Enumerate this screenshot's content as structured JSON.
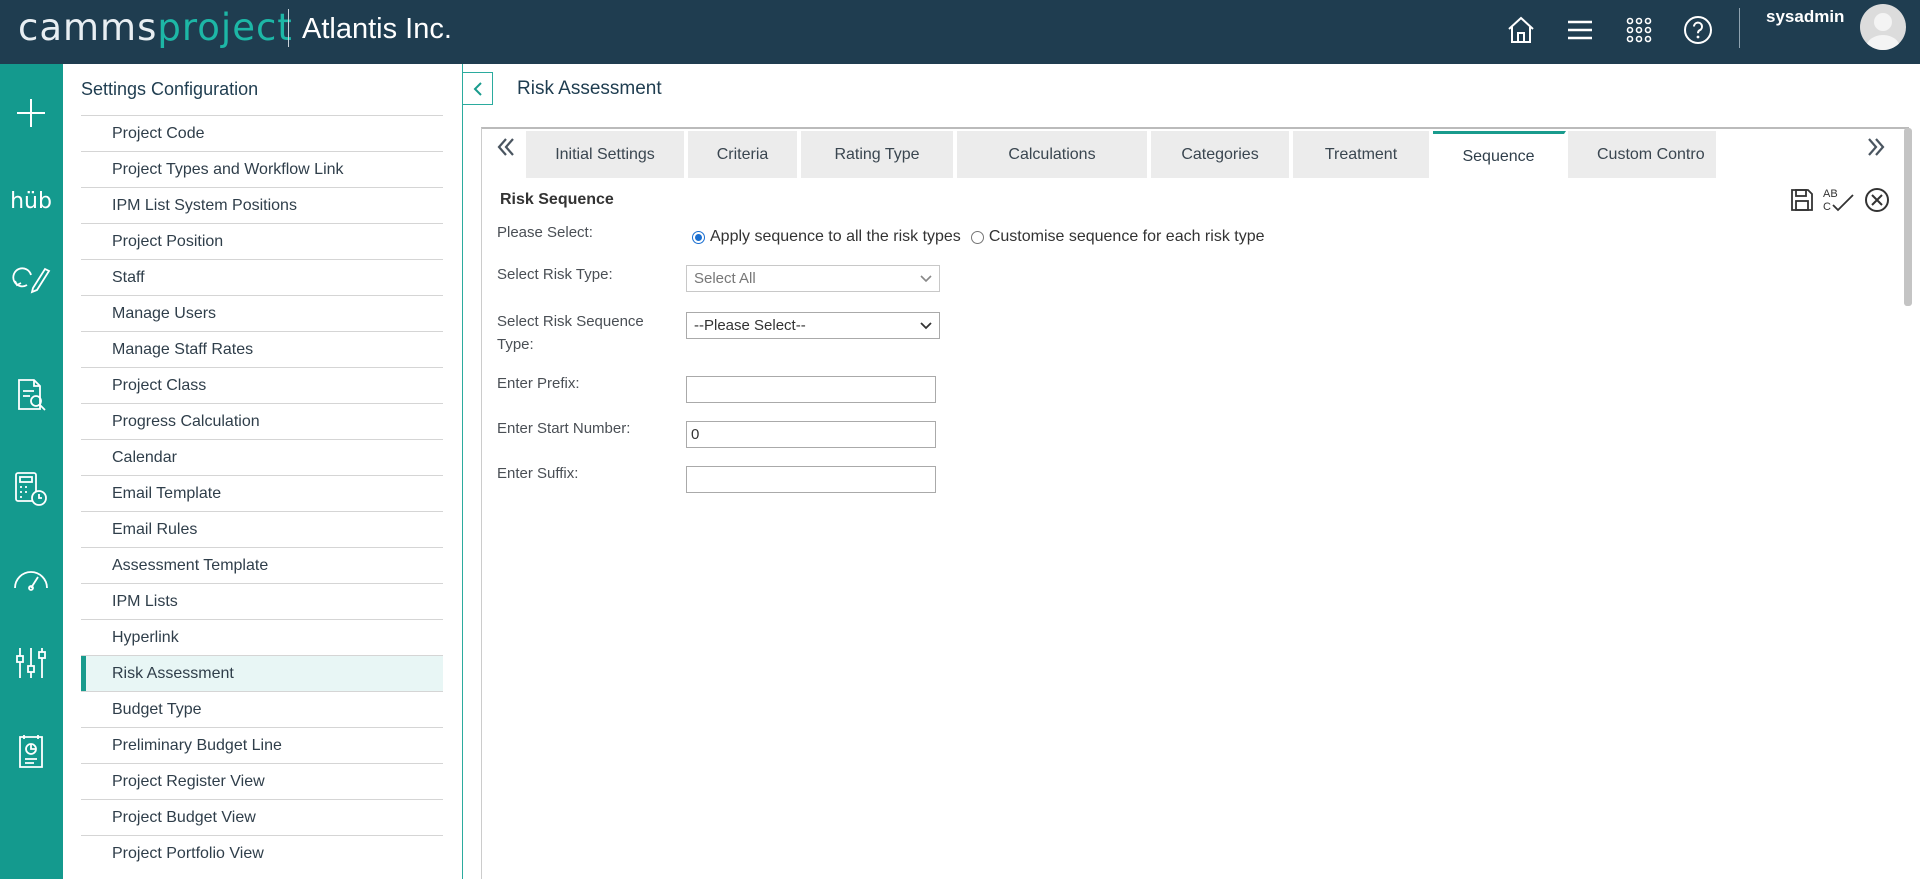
{
  "header": {
    "logo_part1": "camms",
    "logo_part2": "project",
    "company": "Atlantis Inc.",
    "username": "sysadmin",
    "icons": [
      "home-icon",
      "menu-icon",
      "apps-grid-icon",
      "help-icon"
    ]
  },
  "rail": {
    "icons": [
      "add-icon",
      "hub-icon",
      "edit-cycle-icon",
      "document-search-icon",
      "calculator-clock-icon",
      "gauge-icon",
      "settings-sliders-icon",
      "report-icon"
    ],
    "hub_label": "hüb"
  },
  "settings": {
    "title": "Settings Configuration",
    "items": [
      {
        "label": "Project Code"
      },
      {
        "label": "Project Types and Workflow Link"
      },
      {
        "label": "IPM List System Positions"
      },
      {
        "label": "Project Position"
      },
      {
        "label": "Staff"
      },
      {
        "label": "Manage Users"
      },
      {
        "label": "Manage Staff Rates"
      },
      {
        "label": "Project Class"
      },
      {
        "label": "Progress Calculation"
      },
      {
        "label": "Calendar"
      },
      {
        "label": "Email Template"
      },
      {
        "label": "Email Rules"
      },
      {
        "label": "Assessment Template"
      },
      {
        "label": "IPM Lists"
      },
      {
        "label": "Hyperlink"
      },
      {
        "label": "Risk Assessment",
        "active": true
      },
      {
        "label": "Budget Type"
      },
      {
        "label": "Preliminary Budget Line"
      },
      {
        "label": "Project Register View"
      },
      {
        "label": "Project Budget View"
      },
      {
        "label": "Project Portfolio View"
      }
    ]
  },
  "page": {
    "title": "Risk Assessment"
  },
  "tabs": [
    {
      "label": "Initial Settings"
    },
    {
      "label": "Criteria"
    },
    {
      "label": "Rating Type"
    },
    {
      "label": "Calculations"
    },
    {
      "label": "Categories"
    },
    {
      "label": "Treatment"
    },
    {
      "label": "Sequence",
      "active": true
    },
    {
      "label": "Custom Contro"
    }
  ],
  "form": {
    "section_title": "Risk Sequence",
    "please_select_label": "Please Select:",
    "radio_apply_all": "Apply sequence to all the risk types",
    "radio_customise": "Customise sequence for each risk type",
    "selected_radio": "apply_all",
    "risk_type_label": "Select Risk Type:",
    "risk_type_value": "Select All",
    "sequence_type_label": "Select Risk Sequence Type:",
    "sequence_type_value": "--Please Select--",
    "prefix_label": "Enter Prefix:",
    "prefix_value": "",
    "start_number_label": "Enter Start Number:",
    "start_number_value": "0",
    "suffix_label": "Enter Suffix:",
    "suffix_value": ""
  },
  "toolbar": {
    "icons": [
      "save-icon",
      "spellcheck-icon",
      "close-circle-icon"
    ],
    "spellcheck_text": "AB C"
  },
  "colors": {
    "topbar": "#1f3d50",
    "rail": "#149a8e",
    "accent": "#199b8d",
    "logo_accent": "#1db7a6"
  }
}
